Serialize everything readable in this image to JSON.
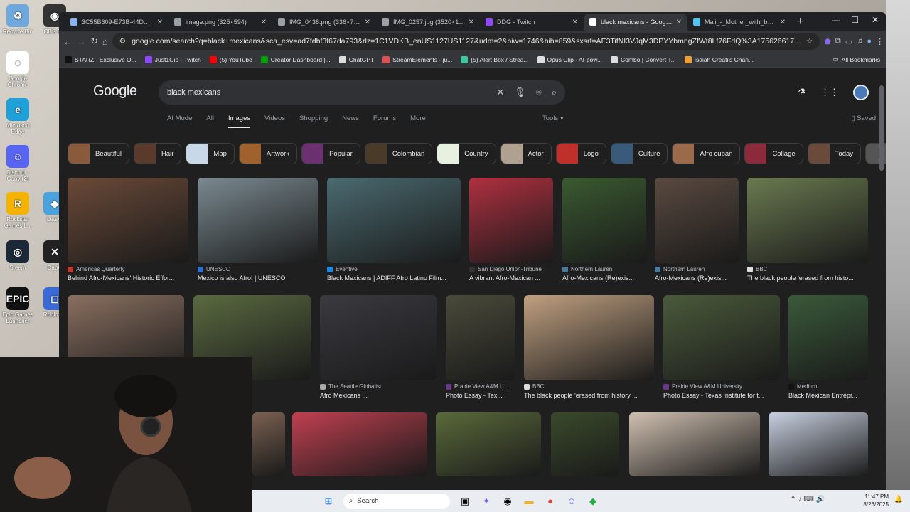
{
  "desktop": {
    "icons": [
      {
        "label": "Recycle Bin",
        "color": "#6fa8dc",
        "glyph": "♻"
      },
      {
        "label": "OBS Stu",
        "color": "#333333",
        "glyph": "◉"
      },
      {
        "label": "Google Chrome",
        "color": "#ffffff",
        "glyph": "●"
      },
      {
        "label": "Microsoft Edge",
        "color": "#1fa0d8",
        "glyph": "e"
      },
      {
        "label": "Discord - Copy (2)",
        "color": "#5865f2",
        "glyph": "☺"
      },
      {
        "label": "Rockstar Games L...",
        "color": "#f5b300",
        "glyph": "R"
      },
      {
        "label": "Steam",
        "color": "#1b2838",
        "glyph": "◎"
      },
      {
        "label": "Epic Games Launcher",
        "color": "#111111",
        "glyph": "EPIC"
      },
      {
        "label": "LetsVi",
        "color": "#4aa3df",
        "glyph": "◆"
      },
      {
        "label": "CapC",
        "color": "#222222",
        "glyph": "✕"
      },
      {
        "label": "Roblox P",
        "color": "#3a6ad8",
        "glyph": "◻"
      }
    ]
  },
  "browser": {
    "tabs": [
      {
        "title": "3C55B609-E73B-44DB-826",
        "fav": "#8ab4f8",
        "active": false
      },
      {
        "title": "image.png (325×594)",
        "fav": "#9aa0a6",
        "active": false
      },
      {
        "title": "IMG_0438.png (336×727)",
        "fav": "#9aa0a6",
        "active": false
      },
      {
        "title": "IMG_0257.jpg (3520×1980)",
        "fav": "#9aa0a6",
        "active": false
      },
      {
        "title": "DDG - Twitch",
        "fav": "#9146ff",
        "active": false
      },
      {
        "title": "black mexicans - Google Se",
        "fav": "#ffffff",
        "active": true
      },
      {
        "title": "Mali_-_Mother_with_baby.j",
        "fav": "#4fc3f7",
        "active": false
      }
    ],
    "new_tab": "+",
    "window_controls": {
      "minimize": "—",
      "maximize": "☐",
      "close": "✕"
    },
    "url": "google.com/search?q=black+mexicans&sca_esv=ad7fdbf3f67da793&rlz=1C1VDKB_enUS1127US1127&udm=2&biw=1746&bih=859&sxsrf=AE3TifNI3VJqM3DPYYbmngZfWt8Lf76FdQ%3A175626617...",
    "bookmarks": [
      {
        "label": "STARZ - Exclusive O...",
        "color": "#111111"
      },
      {
        "label": "Just1Gio - Twitch",
        "color": "#9146ff"
      },
      {
        "label": "(5) YouTube",
        "color": "#ff0000"
      },
      {
        "label": "Creator Dashboard |...",
        "color": "#00a000"
      },
      {
        "label": "ChatGPT",
        "color": "#dddddd"
      },
      {
        "label": "StreamElements - ju...",
        "color": "#e05050"
      },
      {
        "label": "(5) Alert Box / Strea...",
        "color": "#3cc8a0"
      },
      {
        "label": "Opus Clip - AI-pow...",
        "color": "#dddddd"
      },
      {
        "label": "Combo | Convert T...",
        "color": "#dddddd"
      },
      {
        "label": "Isaiah Creati's Chan...",
        "color": "#f0a030"
      }
    ],
    "all_bookmarks": "All Bookmarks"
  },
  "google": {
    "logo": "Google",
    "query": "black mexicans",
    "filters": [
      "AI Mode",
      "All",
      "Images",
      "Videos",
      "Shopping",
      "News",
      "Forums",
      "More"
    ],
    "active_filter": "Images",
    "tools": "Tools",
    "saved": "Saved",
    "chips": [
      {
        "label": "Beautiful",
        "color": "#8a5a3c"
      },
      {
        "label": "Hair",
        "color": "#5a3a2a"
      },
      {
        "label": "Map",
        "color": "#c8d8e8"
      },
      {
        "label": "Artwork",
        "color": "#a0622c"
      },
      {
        "label": "Popular",
        "color": "#6a3070"
      },
      {
        "label": "Colombian",
        "color": "#4a3a2a"
      },
      {
        "label": "Country",
        "color": "#e8f0e0"
      },
      {
        "label": "Actor",
        "color": "#b0a090"
      },
      {
        "label": "Logo",
        "color": "#c0302a"
      },
      {
        "label": "Culture",
        "color": "#3a5a7a"
      },
      {
        "label": "Afro cuban",
        "color": "#9a6a4a"
      },
      {
        "label": "Collage",
        "color": "#8a2a3a"
      },
      {
        "label": "Today",
        "color": "#6a4a3a"
      },
      {
        "label": "G",
        "color": "#555555"
      }
    ],
    "results_row1": [
      {
        "source": "Americas Quarterly",
        "caption": "Behind Afro-Mexicans' Historic Effor...",
        "color": "#6b4a38",
        "fav": "#c0392b"
      },
      {
        "source": "UNESCO",
        "caption": "Mexico is also Afro! | UNESCO",
        "color": "#7a8a90",
        "fav": "#2e6fd8"
      },
      {
        "source": "Eventive",
        "caption": "Black Mexicans | ADIFF Afro Latino Film...",
        "color": "#4a6a70",
        "fav": "#1e88e5"
      },
      {
        "source": "San Diego Union-Tribune",
        "caption": "A vibrant Afro-Mexican ...",
        "color": "#b03040",
        "fav": "#333333"
      },
      {
        "source": "Northern Lauren",
        "caption": "Afro-Mexicans (Re)exis...",
        "color": "#3a5a30",
        "fav": "#4a7a9a"
      },
      {
        "source": "Northern Lauren",
        "caption": "Afro-Mexicans (Re)exis...",
        "color": "#5a4a40",
        "fav": "#4a7a9a"
      },
      {
        "source": "BBC",
        "caption": "The black people 'erased from histo...",
        "color": "#6a7a50",
        "fav": "#dddddd"
      }
    ],
    "results_row2": [
      {
        "source": "",
        "caption": "",
        "color": "#8a7060",
        "fav": "#555555"
      },
      {
        "source": "",
        "caption": "...nt for Constitutio...",
        "color": "#5a6a40",
        "fav": "#555555"
      },
      {
        "source": "The Seattle Globalist",
        "caption": "Afro Mexicans ...",
        "color": "#3a3a40",
        "fav": "#aaaaaa"
      },
      {
        "source": "Prairie View A&M U...",
        "caption": "Photo Essay - Tex...",
        "color": "#4a4a3a",
        "fav": "#6a3a8a"
      },
      {
        "source": "BBC",
        "caption": "The black people 'erased from history ...",
        "color": "#c0a080",
        "fav": "#dddddd"
      },
      {
        "source": "Prairie View A&M University",
        "caption": "Photo Essay - Texas Institute for t...",
        "color": "#4a5a3a",
        "fav": "#6a3a8a"
      },
      {
        "source": "Medium",
        "caption": "Black Mexican Entrepr...",
        "color": "#3a5a3a",
        "fav": "#111111"
      }
    ],
    "results_row3": [
      {
        "color": "#7a6050"
      },
      {
        "color": "#c04050"
      },
      {
        "color": "#5a6a3a"
      },
      {
        "color": "#3a4a2a"
      },
      {
        "color": "#d0c0b0"
      },
      {
        "color": "#c8d0e0"
      }
    ]
  },
  "taskbar": {
    "search_placeholder": "Search",
    "time": "11:47 PM",
    "date": "8/26/2025"
  }
}
